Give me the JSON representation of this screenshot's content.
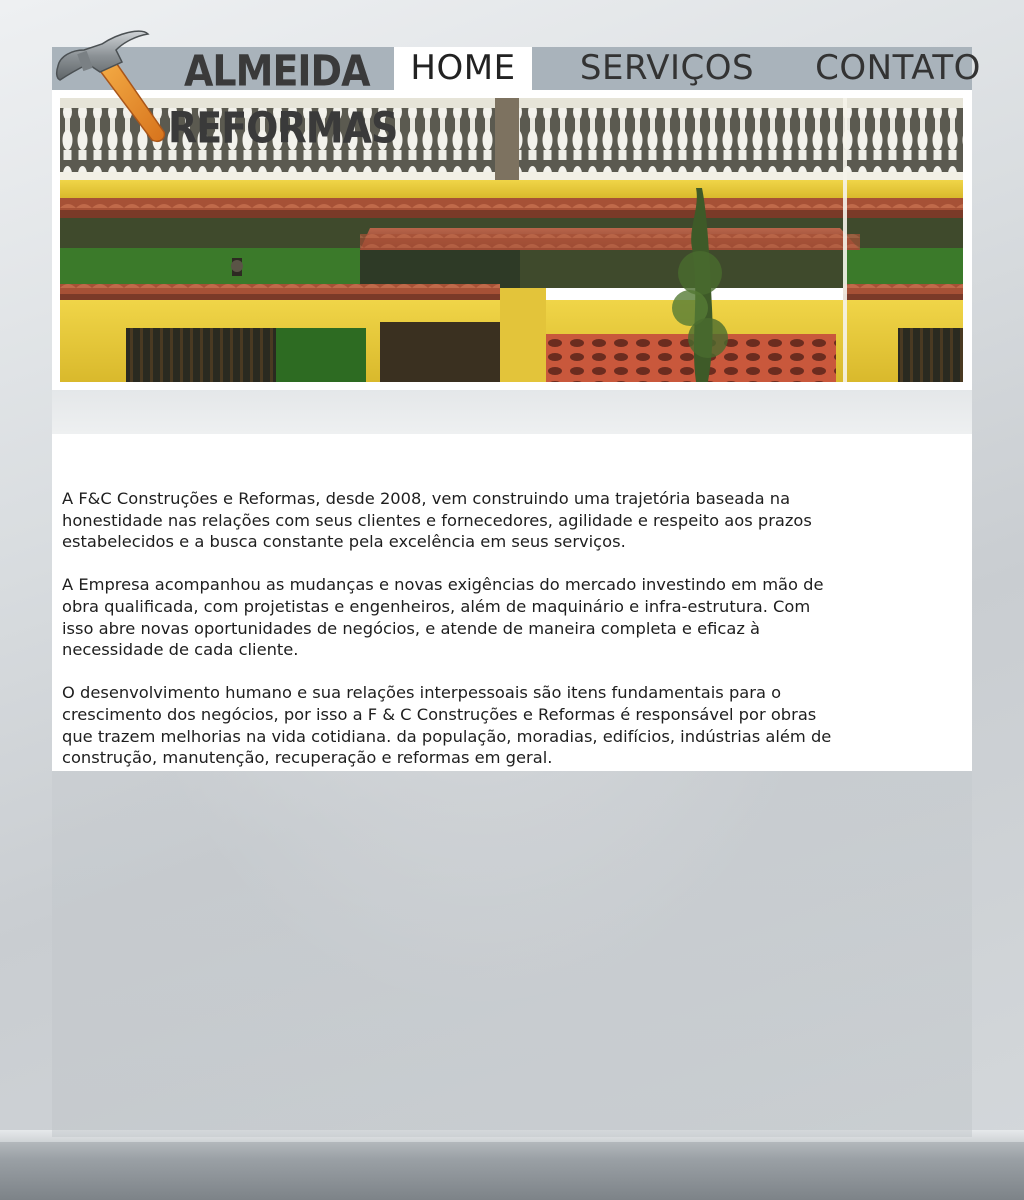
{
  "brand": {
    "line1": "ALMEIDA",
    "line2": "REFORMAS",
    "logo_icon": "hammer-icon"
  },
  "nav": {
    "items": [
      {
        "label": "HOME",
        "active": true
      },
      {
        "label": "SERVIÇOS",
        "active": false
      },
      {
        "label": "CONTATO",
        "active": false
      }
    ]
  },
  "banner": {
    "image": "house-facade-photo",
    "colors": {
      "wall": "#e8c93a",
      "roof": "#a5503a",
      "railing": "#f2f2ee"
    }
  },
  "content": {
    "paragraphs": [
      "A F&C Construções e Reformas, desde 2008, vem construindo uma trajetória baseada na honestidade nas relações com seus clientes e fornecedores, agilidade e respeito aos prazos estabelecidos e a busca constante pela excelência em seus serviços.",
      "A Empresa acompanhou as mudanças e novas exigências do mercado investindo em mão de obra qualificada, com projetistas e engenheiros, além de maquinário e infra-estrutura. Com isso abre novas oportunidades de negócios, e atende de maneira completa e eficaz à necessidade de cada cliente.",
      "O desenvolvimento humano e sua relações interpessoais são itens fundamentais para o crescimento dos negócios, por isso a F & C Construções e Reformas é responsável por obras que trazem melhorias na vida cotidiana. da população, moradias, edifícios, indústrias além de construção, manutenção, recuperação e reformas em geral."
    ]
  },
  "colors": {
    "navbar": "#a9b3bb",
    "active_tab": "#ffffff",
    "text": "#1e1e1e"
  }
}
